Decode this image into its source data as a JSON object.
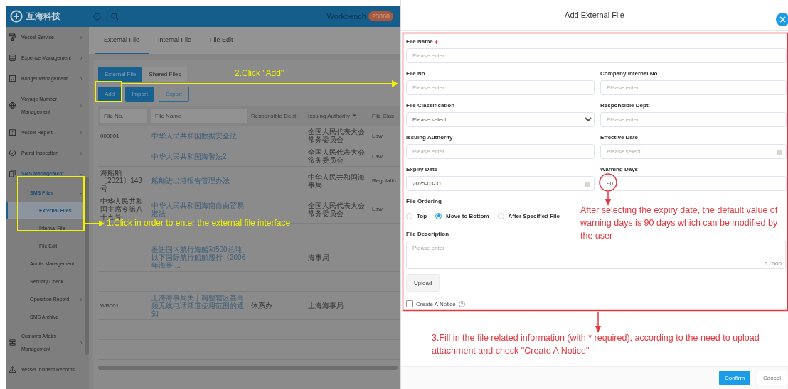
{
  "app": {
    "logo": "互海科技",
    "workbench": "Workbench",
    "badge": "23868"
  },
  "sidebar": {
    "items": [
      {
        "label": "Vessel Service",
        "expanded": false,
        "selected": false
      },
      {
        "label": "Expense Management",
        "expanded": false,
        "selected": false
      },
      {
        "label": "Budget Management",
        "expanded": false,
        "selected": false
      },
      {
        "label": "Voyage Number Management",
        "expanded": false,
        "selected": false
      },
      {
        "label": "Vessel Report",
        "expanded": false,
        "selected": false
      },
      {
        "label": "Patrol Inspection",
        "expanded": false,
        "selected": false
      },
      {
        "label": "SMS Management",
        "expanded": true,
        "selected": false,
        "children": [
          {
            "label": "SMS Files",
            "expanded": true,
            "selected": false,
            "children": [
              {
                "label": "External Files",
                "selected": true
              },
              {
                "label": "Internal File",
                "selected": false
              },
              {
                "label": "File Edit",
                "selected": false
              }
            ]
          },
          {
            "label": "Audits Management",
            "selected": false
          },
          {
            "label": "Security Check",
            "selected": false
          },
          {
            "label": "Operation Record",
            "expanded": false,
            "selected": false
          },
          {
            "label": "SMS Archive",
            "selected": false
          }
        ]
      },
      {
        "label": "Customs Affairs Management",
        "expanded": false,
        "selected": false
      },
      {
        "label": "Vessel Incident Records",
        "selected": false
      }
    ]
  },
  "page_tabs": [
    {
      "label": "External File",
      "selected": true
    },
    {
      "label": "Internal File",
      "selected": false
    },
    {
      "label": "File Edit",
      "selected": false
    }
  ],
  "sub_tabs": [
    {
      "label": "External File",
      "selected": true
    },
    {
      "label": "Shared Files",
      "selected": false
    }
  ],
  "toolbar": [
    {
      "label": "Add",
      "kind": "primary"
    },
    {
      "label": "Import",
      "kind": "primary"
    },
    {
      "label": "Export",
      "kind": "outline"
    }
  ],
  "table": {
    "columns": [
      {
        "placeholder": "File No.",
        "kind": "filter"
      },
      {
        "placeholder": "File Name",
        "kind": "filter"
      },
      {
        "label": "Responsible Dept.",
        "kind": "text"
      },
      {
        "label": "Issuing Authority",
        "kind": "sort"
      },
      {
        "label": "File Clas",
        "kind": "text"
      }
    ],
    "rows": [
      {
        "file_no": "000001",
        "file_name": "中华人民共和国数据安全法",
        "authority": "全国人民代表大会常务委员会",
        "classification": "Law"
      },
      {
        "file_name": "中华人民共和国海警法2",
        "authority": "全国人民代表大会常务委员会",
        "classification": "Law"
      },
      {
        "file_no": "海船舶〔2021〕143号",
        "file_name": "船舶进出港报告管理办法",
        "authority": "中华人民共和国海事局",
        "classification": "Regulatio"
      },
      {
        "file_no": "中华人民共和国主席令第八十五号",
        "file_name": "中华人民共和国海南自由贸易港法",
        "authority": "全国人民代表大会常务委员会",
        "classification": "Law"
      },
      {},
      {
        "file_name": "推进国内航行海船和500总吨以下国际航行船舶履行《2006年海事 ...",
        "authority": "海事局"
      },
      {},
      {
        "file_no": "WB001",
        "file_name": "上海海事局关于调整辖区甚高频无线电话频道使用范围的通知",
        "dept": "体系办",
        "authority": "上海海事局"
      },
      {},
      {}
    ]
  },
  "dialog": {
    "title": "Add External File",
    "fields": [
      {
        "label": "File Name",
        "required": true,
        "kind": "input",
        "placeholder": "Please enter"
      },
      {
        "label": "File No.",
        "required": false,
        "kind": "input",
        "placeholder": "Please enter"
      },
      {
        "label": "Company Internal No.",
        "required": false,
        "kind": "input",
        "placeholder": "Please enter"
      },
      {
        "label": "File Classification",
        "required": false,
        "kind": "select",
        "placeholder": "Please select"
      },
      {
        "label": "Responsible Dept.",
        "required": false,
        "kind": "input",
        "placeholder": "Please enter"
      },
      {
        "label": "Issuing Authority",
        "required": false,
        "kind": "input",
        "placeholder": "Please enter"
      },
      {
        "label": "Effective Date",
        "required": false,
        "kind": "date",
        "placeholder": "Please select"
      },
      {
        "label": "Expiry Date",
        "required": false,
        "kind": "date",
        "value": "2025-03-31"
      },
      {
        "label": "Warning Days",
        "required": false,
        "kind": "input",
        "value": "90"
      }
    ],
    "ordering": {
      "label": "File Ordering",
      "options": [
        {
          "label": "Top",
          "selected": false
        },
        {
          "label": "Move to Bottom",
          "selected": true
        },
        {
          "label": "After Specified File",
          "selected": false
        }
      ]
    },
    "description": {
      "label": "File Description",
      "placeholder": "Please enter",
      "counter": "0 / 500"
    },
    "upload": "Upload",
    "notice": {
      "label": "Create A Notice",
      "checked": false
    },
    "buttons": [
      {
        "label": "Confirm",
        "kind": "primary"
      },
      {
        "label": "Cancel",
        "kind": "outline"
      }
    ]
  },
  "annotations": {
    "step1": "1.Click in order to enter the external file interface",
    "step2": "2.Click \"Add\"",
    "note": "After selecting the expiry date, the default value of warning days is 90 days which can be modified by the user",
    "step3": "3.Fill in the file related information (with * required), according to the need to upload attachment and check \"Create A Notice\""
  }
}
